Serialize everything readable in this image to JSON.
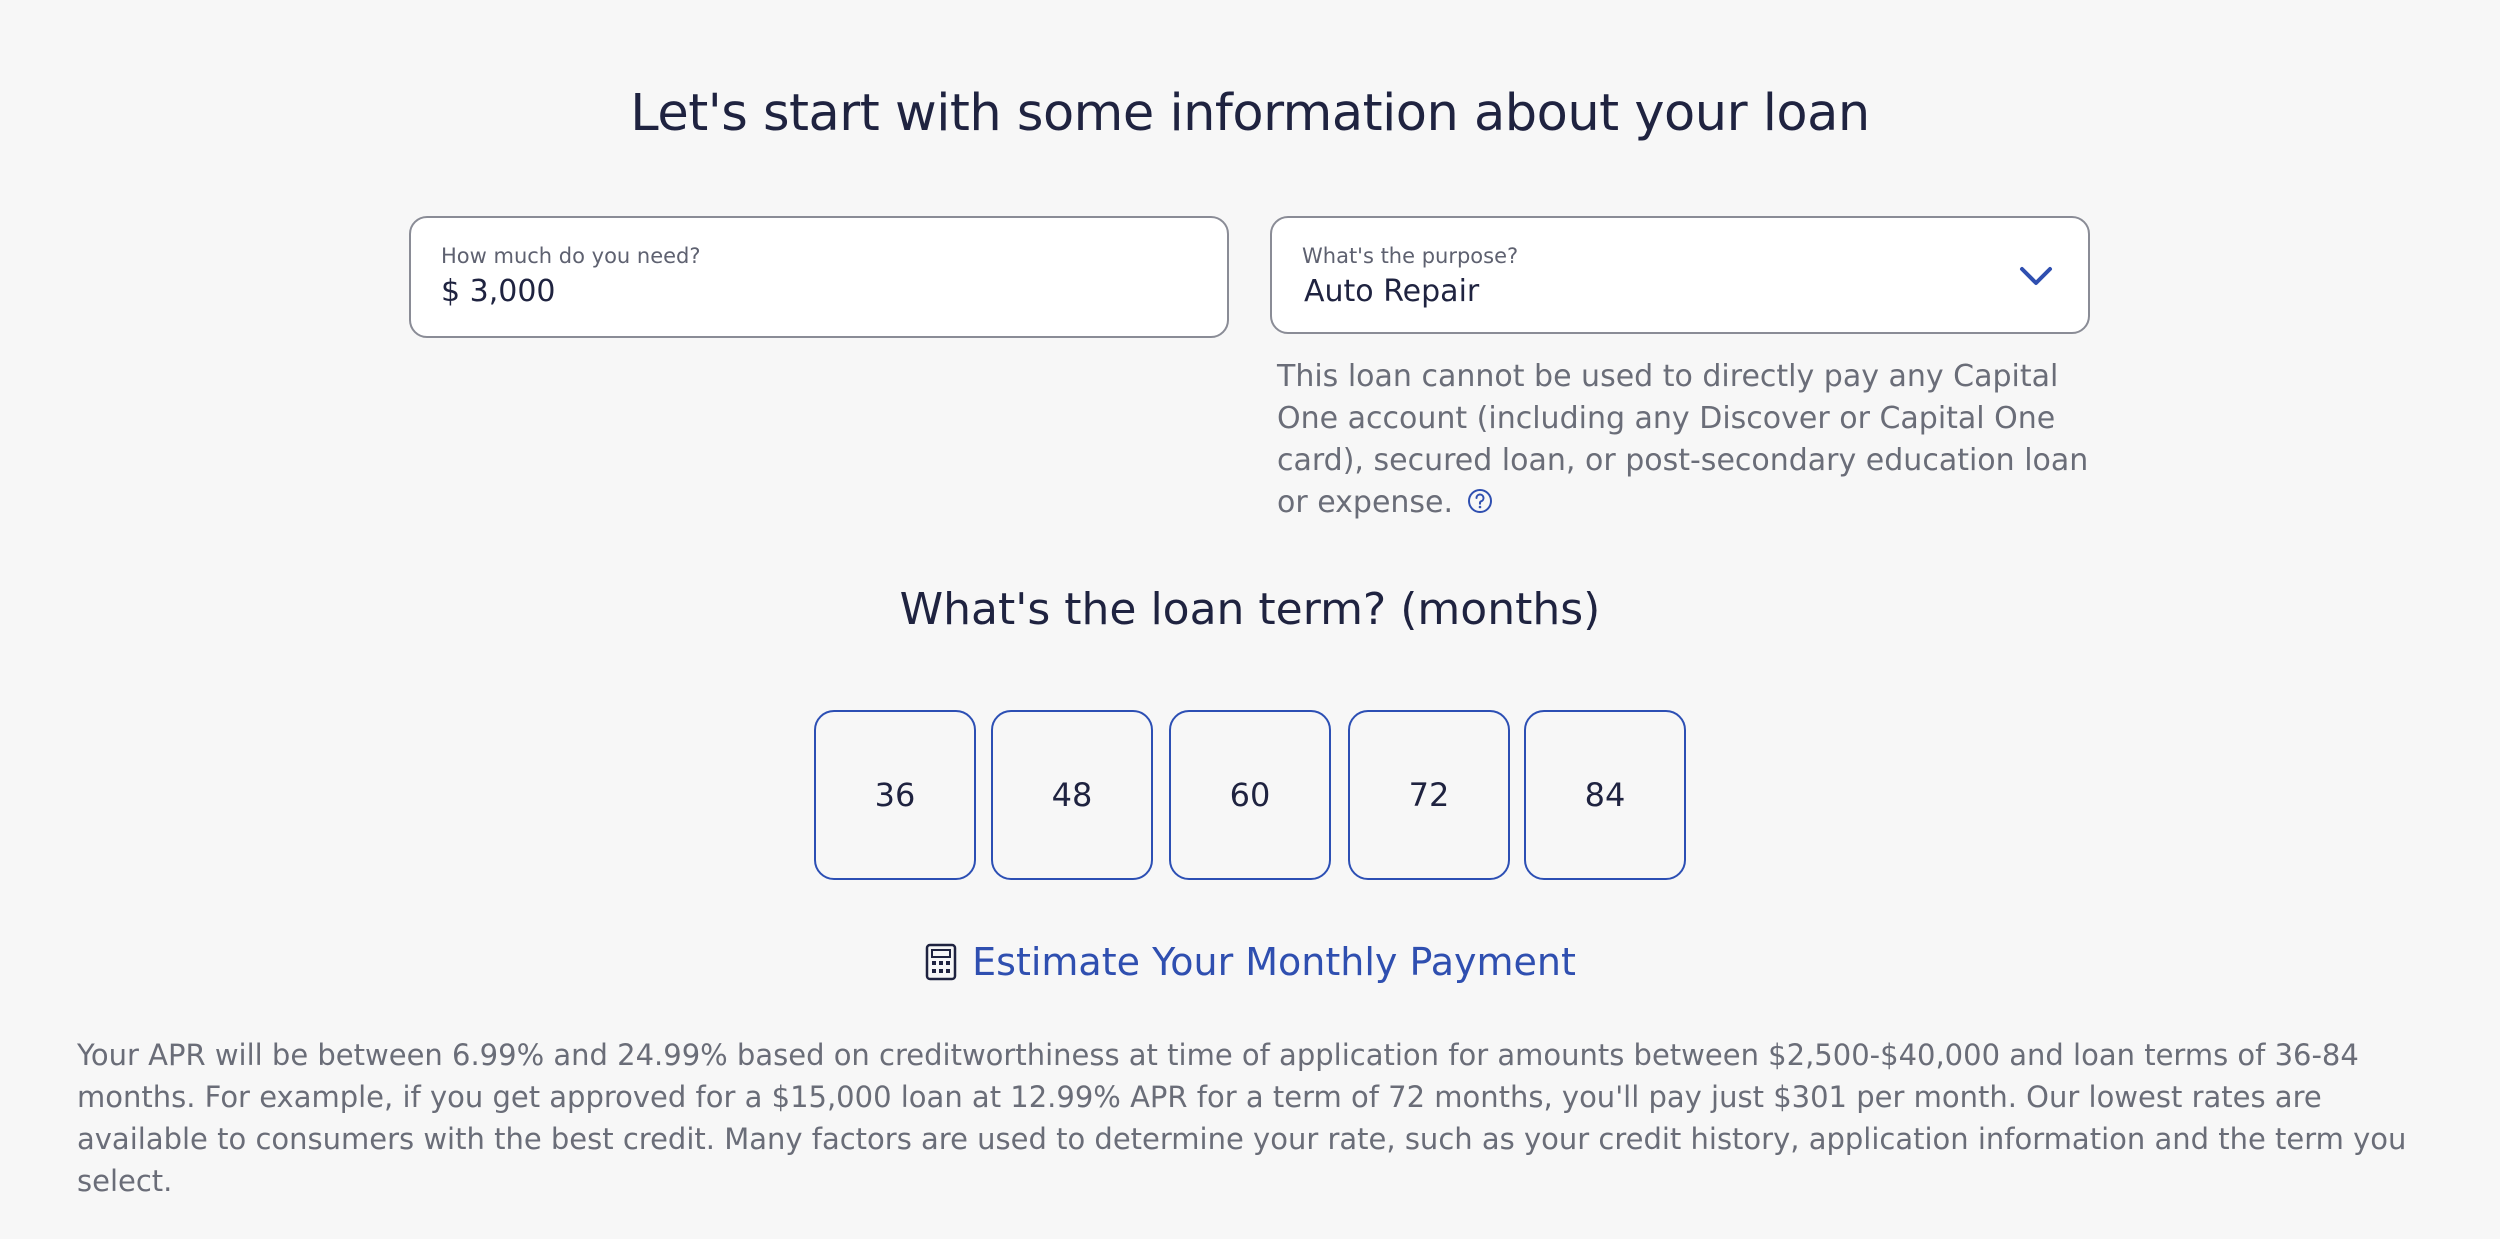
{
  "page": {
    "title": "Let's start with some information about your loan"
  },
  "amount_field": {
    "label": "How much do you need?",
    "value": "$ 3,000"
  },
  "purpose_field": {
    "label": "What's the purpose?",
    "selected": "Auto Repair",
    "disclaimer": "This loan cannot be used to directly pay any Capital One account (including any Discover or Capital One card), secured loan, or post-secondary education loan or expense."
  },
  "loan_term": {
    "title": "What's the loan term? (months)",
    "options": [
      "36",
      "48",
      "60",
      "72",
      "84"
    ]
  },
  "estimate": {
    "label": "Estimate Your Monthly Payment"
  },
  "apr_disclosure": "Your APR will be between 6.99% and 24.99% based on creditworthiness at time of application for amounts between $2,500-$40,000 and loan terms of 36-84 months. For example, if you get approved for a $15,000 loan at 12.99% APR for a term of 72 months, you'll pay just $301 per month. Our lowest rates are available to consumers with the best credit. Many factors are used to determine your rate, such as your credit history, application information and the term you select.",
  "colors": {
    "accent": "#2f4fb0",
    "text_dark": "#1f2340",
    "text_muted": "#6a6d78",
    "background": "#f7f7f7"
  },
  "icons": {
    "purpose_dropdown": "chevron-down-icon",
    "disclaimer_help": "question-circle-icon",
    "estimate": "calculator-icon"
  }
}
